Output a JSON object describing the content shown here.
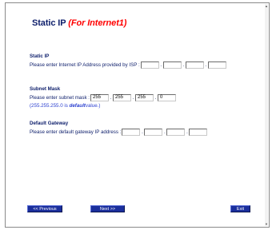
{
  "header": {
    "title": "Static IP",
    "subtitle": "(For Internet1)"
  },
  "static_ip": {
    "heading": "Static IP",
    "prompt": "Please enter Internet IP Address provided by ISP :",
    "octets": [
      "",
      "",
      "",
      ""
    ]
  },
  "subnet_mask": {
    "heading": "Subnet Mask",
    "prompt": "Please enter subnet mask :",
    "octets": [
      "255",
      "255",
      "255",
      "0"
    ],
    "hint_value": "(255.255.255.0 is",
    "hint_default": "default",
    "hint_suffix": "value.)"
  },
  "default_gateway": {
    "heading": "Default Gateway",
    "prompt": "Please enter default gateway IP address :",
    "octets": [
      "",
      "",
      "",
      ""
    ]
  },
  "buttons": {
    "previous": "<< Previous",
    "next": "Next >>",
    "exit": "Exit"
  },
  "colors": {
    "text": "#0d1e6b",
    "accent": "#ff0000",
    "hint": "#2a3fd0",
    "button": "#1b2f9c"
  }
}
